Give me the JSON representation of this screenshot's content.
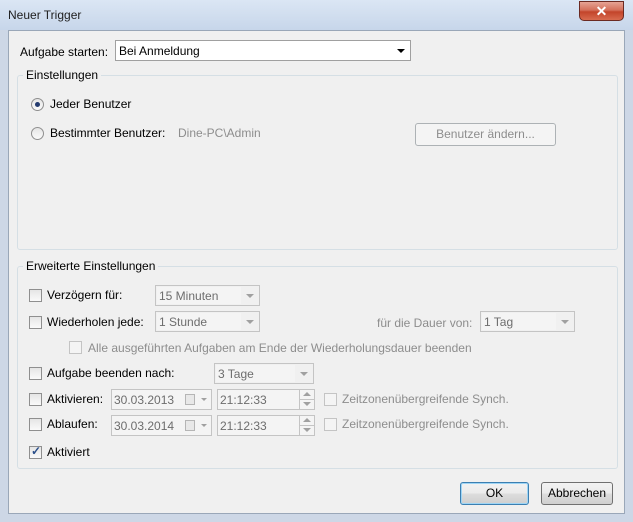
{
  "window": {
    "title": "Neuer Trigger",
    "close_glyph": "✕"
  },
  "start": {
    "label": "Aufgabe starten:",
    "value": "Bei Anmeldung"
  },
  "settings": {
    "title": "Einstellungen",
    "all_users": "Jeder Benutzer",
    "specific_user": "Bestimmter Benutzer:",
    "user_name": "Dine-PC\\Admin",
    "change_user_button": "Benutzer ändern..."
  },
  "advanced": {
    "title": "Erweiterte Einstellungen",
    "delay": {
      "label": "Verzögern für:",
      "value": "15 Minuten",
      "checked": false
    },
    "repeat": {
      "label": "Wiederholen jede:",
      "value": "1 Stunde",
      "checked": false,
      "duration_label": "für die Dauer von:",
      "duration_value": "1 Tag"
    },
    "stop_all": {
      "label": "Alle ausgeführten Aufgaben am Ende der Wiederholungsdauer beenden",
      "checked": false
    },
    "stop_after": {
      "label": "Aufgabe beenden nach:",
      "value": "3 Tage",
      "checked": false
    },
    "activate": {
      "label": "Aktivieren:",
      "date": "30.03.2013",
      "time": "21:12:33",
      "sync_label": "Zeitzonenübergreifende Synch.",
      "checked": false
    },
    "expire": {
      "label": "Ablaufen:",
      "date": "30.03.2014",
      "time": "21:12:33",
      "sync_label": "Zeitzonenübergreifende Synch.",
      "checked": false
    },
    "enabled": {
      "label": "Aktiviert",
      "checked": true
    }
  },
  "buttons": {
    "ok": "OK",
    "cancel": "Abbrechen"
  },
  "glyphs": {
    "check": "✓"
  }
}
